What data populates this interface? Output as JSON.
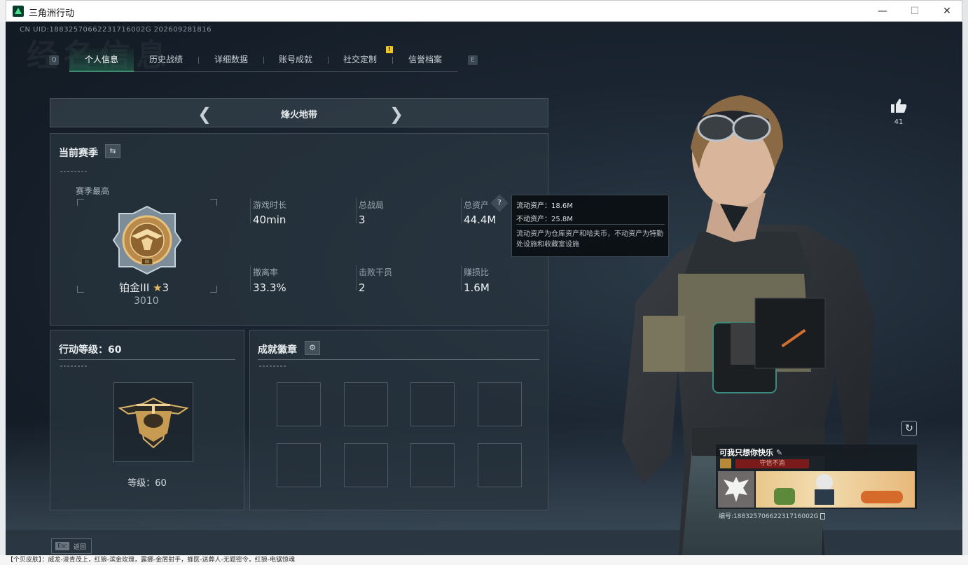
{
  "window": {
    "title": "三角洲行动"
  },
  "header": {
    "uid": "CN UID:18832570662231716002G 202609281816",
    "bg_title": "经名信息"
  },
  "tabs": {
    "left_key": "Q",
    "right_key": "E",
    "items": [
      {
        "label": "个人信息",
        "active": true
      },
      {
        "label": "历史战绩"
      },
      {
        "label": "详细数据"
      },
      {
        "label": "账号成就"
      },
      {
        "label": "社交定制",
        "badge": "!"
      },
      {
        "label": "信誉档案"
      }
    ]
  },
  "mode": {
    "title": "烽火地带"
  },
  "season": {
    "title": "当前赛季",
    "highest_label": "赛季最高",
    "rank_name": "铂金III",
    "rank_stars": "3",
    "rank_score": "3010",
    "stats": [
      {
        "label": "游戏时长",
        "value": "40min"
      },
      {
        "label": "总战局",
        "value": "3"
      },
      {
        "label": "总资产",
        "value": "44.4M"
      },
      {
        "label": "撤离率",
        "value": "33.3%"
      },
      {
        "label": "击败干员",
        "value": "2"
      },
      {
        "label": "赚损比",
        "value": "1.6M"
      }
    ]
  },
  "tooltip": {
    "liquid": "流动资产：18.6M",
    "fixed": "不动资产：25.8M",
    "desc": "流动资产为仓库资产和哈夫币，不动资产为特勤处设施和收藏室设施"
  },
  "level": {
    "title": "行动等级：60",
    "label": "等级：60"
  },
  "badges": {
    "title": "成就徽章"
  },
  "profile": {
    "likes": "41",
    "name": "可我只想你快乐",
    "motto": "守信不渝",
    "id_label": "编号:18832570662231716002G"
  },
  "footer": {
    "esc_key": "Esc",
    "esc_label": "返回",
    "taskbar": "【个贝皮肤】：威龙-浚青茂上，红狼-滨金玫瑰，露娜-金屑射手，蜂医-送葬人-无题密令，红狼-电锯惊魂"
  },
  "colors": {
    "accent": "#39d98a",
    "badge": "#f5c518",
    "motto_bg": "#7a1a1a"
  }
}
